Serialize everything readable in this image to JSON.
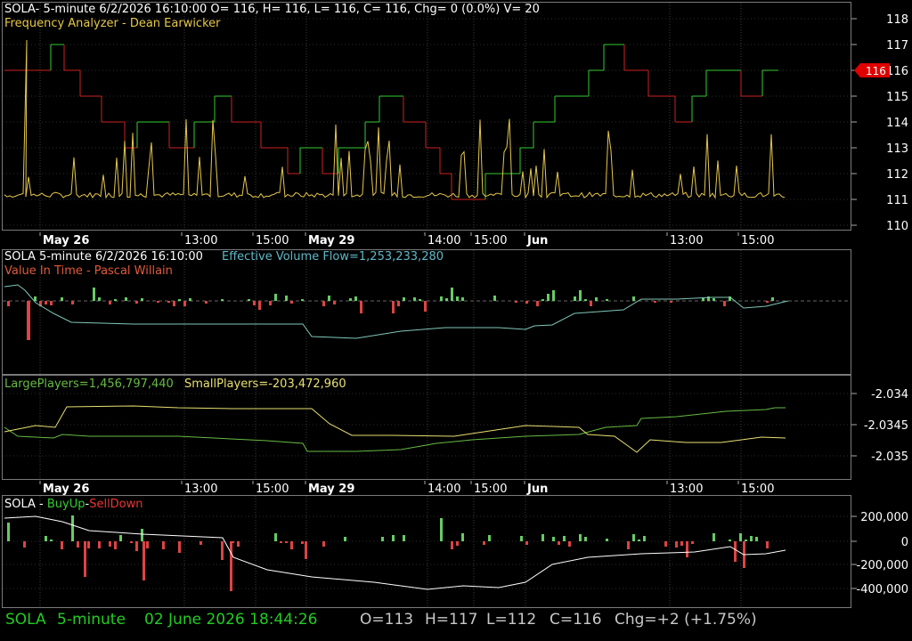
{
  "panels": {
    "price": {
      "header": "SOLA- 5-minute 6/2/2026 16:10:00 O= 116, H= 116, L= 116, C= 116, Chg= 0 (0.0%) V= 20",
      "indicator": "Frequency Analyzer - Dean Earwicker",
      "y_ticks": [
        "118",
        "117",
        "116",
        "115",
        "114",
        "113",
        "112",
        "111",
        "110"
      ],
      "last_price": "116"
    },
    "volume_flow": {
      "header_left": "SOLA 5-minute  6/2/2026 16:10:00",
      "header_right": "Effective Volume Flow=1,253,233,280",
      "indicator": "Value In Time - Pascal Willain"
    },
    "players": {
      "large_label": "LargePlayers=1,456,797,440",
      "small_label": "SmallPlayers=-203,472,960",
      "y_ticks": [
        "-2.034",
        "-2.0345",
        "-2.035"
      ]
    },
    "buysell": {
      "prefix": "SOLA - ",
      "buy_label": "BuyUp",
      "dash": "-",
      "sell_label": "SellDown",
      "y_ticks": [
        "200,000",
        "0",
        "-200,000",
        "-400,000"
      ]
    }
  },
  "x_axis": {
    "labels": [
      "May 26",
      "13:00",
      "15:00",
      "May 29",
      "14:00",
      "15:00",
      "Jun",
      "13:00",
      "15:00"
    ],
    "bold": [
      true,
      false,
      false,
      true,
      false,
      false,
      true,
      false,
      false
    ]
  },
  "status_bar": {
    "symbol": "SOLA",
    "interval": "5-minute",
    "datetime": "02 June 2026 18:44:26",
    "open": "O=113",
    "high": "H=117",
    "low": "L=112",
    "close": "C=116",
    "change": "Chg=+2 (+1.75%)"
  },
  "colors": {
    "up": "#33cc33",
    "down": "#cc2222",
    "oscillator": "#e6c84a",
    "flow_line": "#7fc7b8",
    "large_players": "#66bb44",
    "small_players": "#e8e070",
    "axis_text": "#ffffff",
    "price_tag": "#e00000"
  }
}
